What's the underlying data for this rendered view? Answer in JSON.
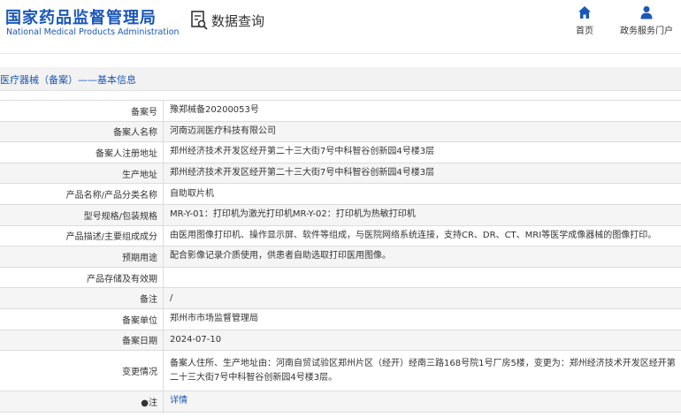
{
  "header": {
    "logo_cn": "国家药品监督管理局",
    "logo_en": "National Medical Products Administration",
    "query_label": "数据查询",
    "home_label": "首页",
    "portal_label": "政务服务门户"
  },
  "breadcrumb": "医疗器械（备案）——基本信息",
  "rows": [
    {
      "label": "备案号",
      "value": "豫郑械备20200053号"
    },
    {
      "label": "备案人名称",
      "value": "河南迈润医疗科技有限公司"
    },
    {
      "label": "备案人注册地址",
      "value": "郑州经济技术开发区经开第二十三大街7号中科智谷创新园4号楼3层"
    },
    {
      "label": "生产地址",
      "value": "郑州经济技术开发区经开第二十三大街7号中科智谷创新园4号楼3层"
    },
    {
      "label": "产品名称/产品分类名称",
      "value": "自助取片机"
    },
    {
      "label": "型号规格/包装规格",
      "value": "MR-Y-01：打印机为激光打印机MR-Y-02：打印机为热敏打印机"
    },
    {
      "label": "产品描述/主要组成成分",
      "value": "由医用图像打印机、操作显示屏、软件等组成，与医院网络系统连接，支持CR、DR、CT、MRI等医学成像器械的图像打印。"
    },
    {
      "label": "预期用途",
      "value": "配合影像记录介质使用，供患者自助选取打印医用图像。"
    },
    {
      "label": "产品存储及有效期",
      "value": ""
    },
    {
      "label": "备注",
      "value": "/"
    },
    {
      "label": "备案单位",
      "value": "郑州市市场监督管理局"
    },
    {
      "label": "备案日期",
      "value": "2024-07-10"
    },
    {
      "label": "变更情况",
      "value": "备案人住所、生产地址由：河南自贸试验区郑州片区（经开）经南三路168号院1号厂房5楼，变更为：郑州经济技术开发区经开第二十三大街7号中科智谷创新园4号楼3层。"
    },
    {
      "label": "●注",
      "value": "详情"
    }
  ],
  "colors": {
    "brand": "#1a57b8",
    "row_alt": "#f5f5f5",
    "border": "#dcdcdc"
  }
}
